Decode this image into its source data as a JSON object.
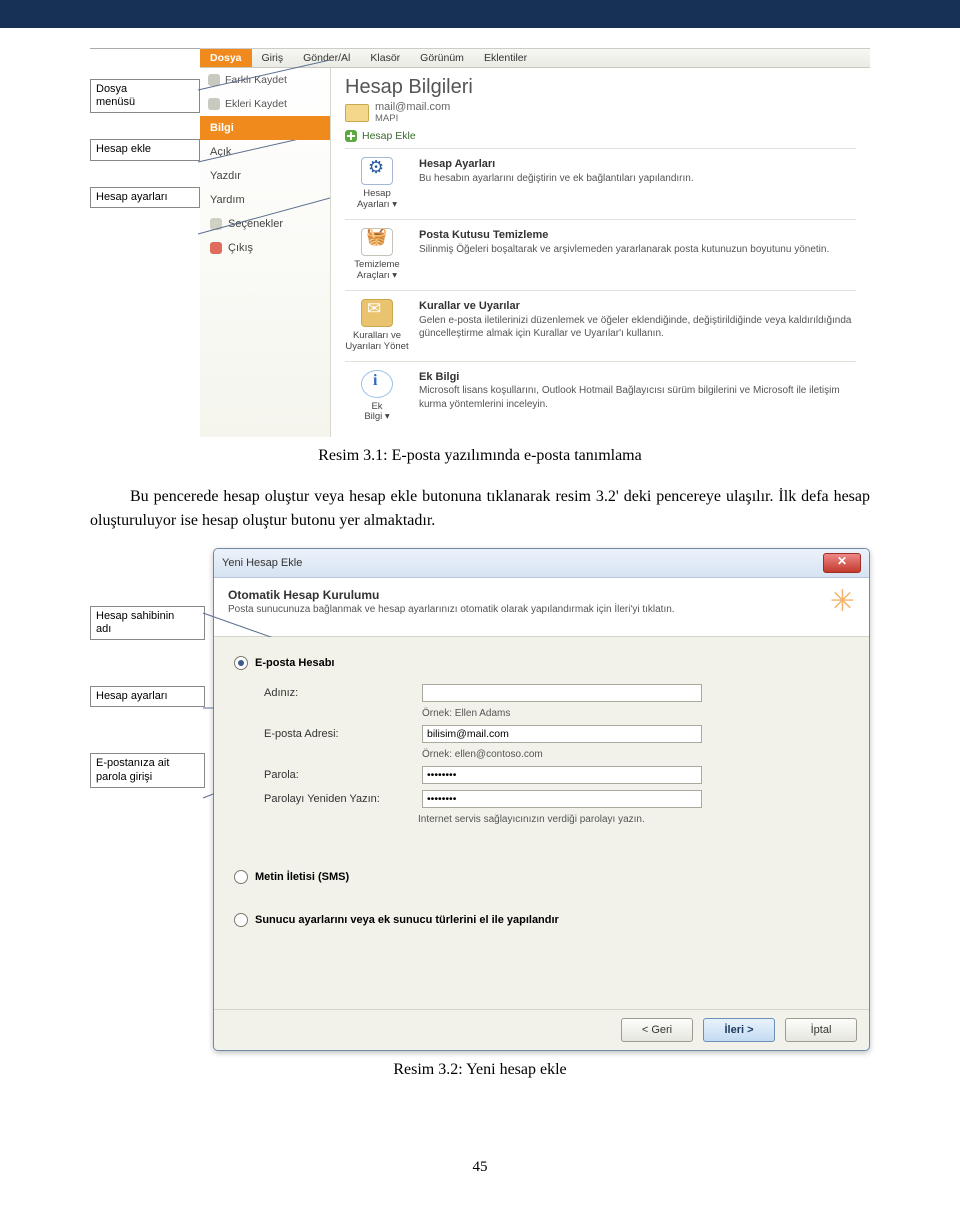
{
  "captions": {
    "fig1": "Resim 3.1: E-posta yazılımında e-posta tanımlama",
    "fig2": "Resim 3.2: Yeni hesap ekle"
  },
  "body_para": "Bu pencerede hesap oluştur veya hesap ekle butonuna tıklanarak resim 3.2' deki pencereye ulaşılır. İlk defa hesap oluşturuluyor ise hesap oluştur butonu yer almaktadır.",
  "page_no": "45",
  "annot1": {
    "a": "Dosya\nmenüsü",
    "b": "Hesap ekle",
    "c": "Hesap ayarları"
  },
  "ribbon": {
    "tabs": [
      "Dosya",
      "Giriş",
      "Gönder/Al",
      "Klasör",
      "Görünüm",
      "Eklentiler"
    ]
  },
  "sidemenu": {
    "saveas": "Farklı Kaydet",
    "saveatt": "Ekleri Kaydet",
    "selected": "Bilgi",
    "items": [
      "Açık",
      "Yazdır",
      "Yardım"
    ],
    "options": "Seçenekler",
    "exit": "Çıkış"
  },
  "content": {
    "title": "Hesap Bilgileri",
    "mail": "mail@mail.com",
    "proto": "MAPI",
    "add": "Hesap Ekle",
    "sec": [
      {
        "btn": "Hesap\nAyarları ▾",
        "title": "Hesap Ayarları",
        "desc": "Bu hesabın ayarlarını değiştirin ve ek bağlantıları yapılandırın."
      },
      {
        "btn": "Temizleme\nAraçları ▾",
        "title": "Posta Kutusu Temizleme",
        "desc": "Silinmiş Öğeleri boşaltarak ve arşivlemeden yararlanarak posta kutunuzun boyutunu yönetin."
      },
      {
        "btn": "Kuralları ve\nUyarıları Yönet",
        "title": "Kurallar ve Uyarılar",
        "desc": "Gelen e-posta iletilerinizi düzenlemek ve öğeler eklendiğinde, değiştirildiğinde veya kaldırıldığında güncelleştirme almak için Kurallar ve Uyarılar'ı kullanın."
      },
      {
        "btn": "Ek\nBilgi ▾",
        "title": "Ek Bilgi",
        "desc": "Microsoft lisans koşullarını, Outlook Hotmail Bağlayıcısı sürüm bilgilerini ve Microsoft ile iletişim kurma yöntemlerini inceleyin."
      }
    ]
  },
  "annot2": {
    "a": "Hesap sahibinin\nadı",
    "b": "Hesap ayarları",
    "c": "E-postanıza ait\nparola girişi"
  },
  "dlg": {
    "title": "Yeni Hesap Ekle",
    "head_title": "Otomatik Hesap Kurulumu",
    "head_desc": "Posta sunucunuza bağlanmak ve hesap ayarlarınızı otomatik olarak yapılandırmak için İleri'yi tıklatın.",
    "opt_email": "E-posta Hesabı",
    "lbl_name": "Adınız:",
    "hint_name": "Örnek: Ellen Adams",
    "lbl_mail": "E-posta Adresi:",
    "val_mail": "bilisim@mail.com",
    "hint_mail": "Örnek: ellen@contoso.com",
    "lbl_pw": "Parola:",
    "val_pw": "********",
    "lbl_pw2": "Parolayı Yeniden Yazın:",
    "val_pw2": "********",
    "hint_pw": "Internet servis sağlayıcınızın verdiği parolayı yazın.",
    "opt_sms": "Metin İletisi (SMS)",
    "opt_srv": "Sunucu ayarlarını veya ek sunucu türlerini el ile yapılandır",
    "btn_back": "< Geri",
    "btn_next": "İleri >",
    "btn_cancel": "İptal"
  }
}
